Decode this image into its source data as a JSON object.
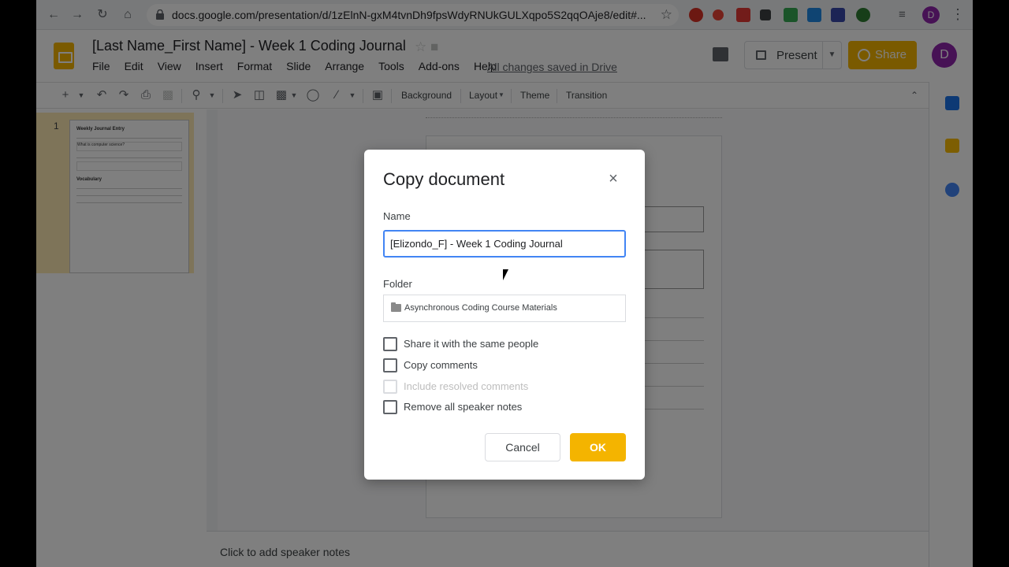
{
  "browser": {
    "url": "docs.google.com/presentation/d/1zElnN-gxM4tvnDh9fpsWdyRNUkGULXqpo5S2qqOAje8/edit#...",
    "profile_initial": "D"
  },
  "app": {
    "title": "[Last Name_First Name] - Week 1 Coding Journal",
    "menu": [
      "File",
      "Edit",
      "View",
      "Insert",
      "Format",
      "Slide",
      "Arrange",
      "Tools",
      "Add-ons",
      "Help"
    ],
    "saved_status": "All changes saved in Drive",
    "present_label": "Present",
    "share_label": "Share",
    "avatar_initial": "D"
  },
  "toolbar": {
    "background": "Background",
    "layout": "Layout",
    "theme": "Theme",
    "transition": "Transition"
  },
  "filmstrip": {
    "slide_number": "1",
    "thumb_title": "Weekly Journal Entry",
    "thumb_question": "What is computer science?",
    "thumb_vocab": "Vocabulary"
  },
  "notes_placeholder": "Click to add speaker notes",
  "dialog": {
    "title": "Copy document",
    "name_label": "Name",
    "name_value": "[Elizondo_F] - Week 1 Coding Journal",
    "folder_label": "Folder",
    "folder_value": "Asynchronous Coding Course Materials",
    "options": [
      {
        "label": "Share it with the same people",
        "checked": false,
        "disabled": false
      },
      {
        "label": "Copy comments",
        "checked": false,
        "disabled": false
      },
      {
        "label": "Include resolved comments",
        "checked": false,
        "disabled": true
      },
      {
        "label": "Remove all speaker notes",
        "checked": false,
        "disabled": false
      }
    ],
    "cancel_label": "Cancel",
    "ok_label": "OK"
  },
  "colors": {
    "accent": "#f4b400",
    "focus": "#4285f4",
    "profile": "#8e24aa"
  }
}
